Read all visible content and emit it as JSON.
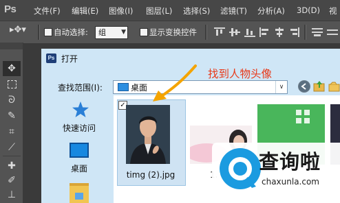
{
  "menubar": {
    "logo": "Ps",
    "items": [
      "文件(F)",
      "编辑(E)",
      "图像(I)",
      "图层(L)",
      "选择(S)",
      "滤镜(T)",
      "分析(A)",
      "3D(D)",
      "视"
    ]
  },
  "options_bar": {
    "auto_select_label": "自动选择:",
    "auto_select_checked": false,
    "auto_select_value": "组",
    "show_transform_label": "显示变换控件",
    "show_transform_checked": false
  },
  "toolbar": {
    "tools": [
      "move-tool",
      "marquee-tool",
      "lasso-tool",
      "quick-selection-tool",
      "crop-tool",
      "eyedropper-tool",
      "healing-brush-tool",
      "brush-tool",
      "clone-stamp-tool",
      "history-brush-tool"
    ]
  },
  "dialog": {
    "title_icon": "Ps",
    "title": "打开",
    "look_in_label": "查找范围(I):",
    "look_in_value": "桌面",
    "places": [
      {
        "label": "快速访问",
        "icon": "star-icon"
      },
      {
        "label": "桌面",
        "icon": "desktop-icon"
      }
    ],
    "files": [
      {
        "name": "timg (2).jpg",
        "selected": true,
        "checked": true
      },
      {
        "name": "1."
      },
      {
        "name": ""
      },
      {
        "name": ""
      }
    ]
  },
  "annotation": {
    "text": "找到人物头像",
    "color": "#e83a1a"
  },
  "watermark": {
    "text": "查询啦",
    "url": "chaxunla.com"
  }
}
